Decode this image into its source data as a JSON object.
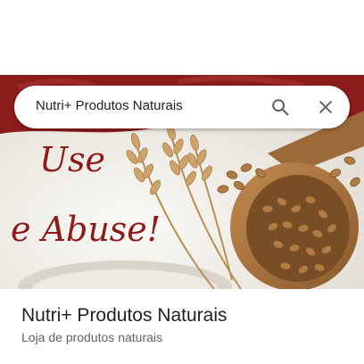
{
  "search": {
    "query": "Nutri+ Produtos Naturais"
  },
  "hero": {
    "slogan_line1": "Use",
    "slogan_line2": "e Abuse!"
  },
  "place": {
    "name": "Nutri+ Produtos Naturais",
    "category": "Loja de produtos naturais"
  },
  "colors": {
    "banner_red": "#8c1c1c",
    "slogan_red": "#8e1a1a",
    "wheat": "#b88e52",
    "spoon": "#a36f3c"
  },
  "icons": {
    "search": "search-icon",
    "close": "close-icon"
  }
}
